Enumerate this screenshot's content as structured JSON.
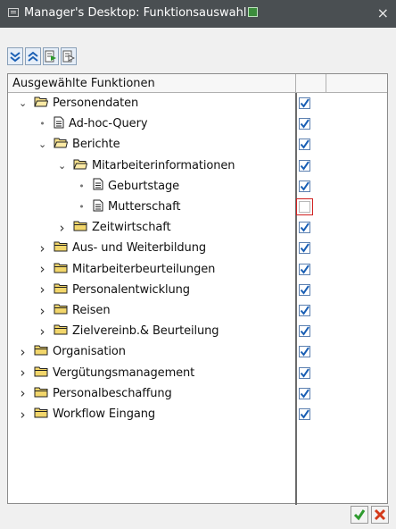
{
  "window": {
    "title": "Manager's Desktop: Funktionsauswahl"
  },
  "toolbar": {
    "icons": [
      "expand-all-icon",
      "collapse-all-icon",
      "select-all-icon",
      "deselect-all-icon"
    ]
  },
  "tree": {
    "header": "Ausgewählte Funktionen",
    "rows": [
      {
        "label": "Personendaten",
        "level": 0,
        "type": "folder-open",
        "expander": "open",
        "checked": true
      },
      {
        "label": "Ad-hoc-Query",
        "level": 1,
        "type": "document",
        "expander": "leaf",
        "checked": true
      },
      {
        "label": "Berichte",
        "level": 1,
        "type": "folder-open",
        "expander": "open",
        "checked": true
      },
      {
        "label": "Mitarbeiterinformationen",
        "level": 2,
        "type": "folder-open",
        "expander": "open",
        "checked": true
      },
      {
        "label": "Geburtstage",
        "level": 3,
        "type": "document",
        "expander": "leaf",
        "checked": true
      },
      {
        "label": "Mutterschaft",
        "level": 3,
        "type": "document",
        "expander": "leaf",
        "checked": false
      },
      {
        "label": "Zeitwirtschaft",
        "level": 2,
        "type": "folder",
        "expander": "closed",
        "checked": true
      },
      {
        "label": "Aus- und Weiterbildung",
        "level": 1,
        "type": "folder",
        "expander": "closed",
        "checked": true
      },
      {
        "label": "Mitarbeiterbeurteilungen",
        "level": 1,
        "type": "folder",
        "expander": "closed",
        "checked": true
      },
      {
        "label": "Personalentwicklung",
        "level": 1,
        "type": "folder",
        "expander": "closed",
        "checked": true
      },
      {
        "label": "Reisen",
        "level": 1,
        "type": "folder",
        "expander": "closed",
        "checked": true
      },
      {
        "label": "Zielvereinb.& Beurteilung",
        "level": 1,
        "type": "folder",
        "expander": "closed",
        "checked": true
      },
      {
        "label": "Organisation",
        "level": 0,
        "type": "folder",
        "expander": "closed",
        "checked": true
      },
      {
        "label": "Vergütungsmanagement",
        "level": 0,
        "type": "folder",
        "expander": "closed",
        "checked": true
      },
      {
        "label": "Personalbeschaffung",
        "level": 0,
        "type": "folder",
        "expander": "closed",
        "checked": true
      },
      {
        "label": "Workflow Eingang",
        "level": 0,
        "type": "folder",
        "expander": "closed",
        "checked": true
      }
    ]
  },
  "buttons": {
    "ok_icon": "checkmark-icon",
    "cancel_icon": "cancel-x-icon"
  },
  "colors": {
    "titlebar": "#4a4f52",
    "check": "#1a5fb4",
    "ok": "#2e9a2e",
    "cancel": "#d43a1a",
    "folder": "#f2d66b"
  }
}
